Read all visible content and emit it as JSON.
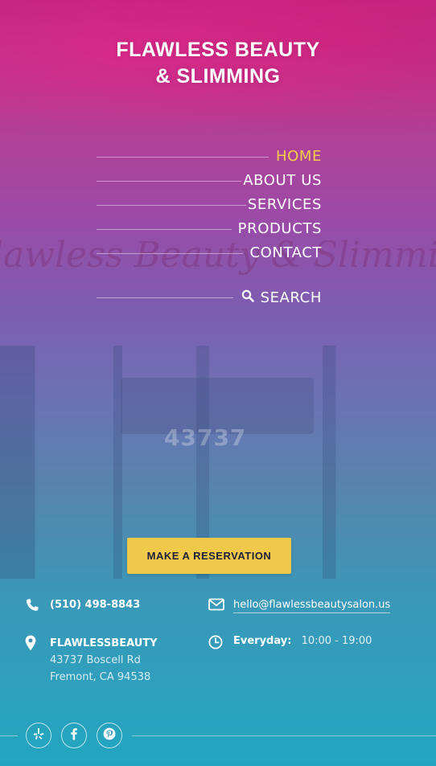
{
  "brand": {
    "line1": "FLAWLESS BEAUTY",
    "line2": "& SLIMMING"
  },
  "background_text": {
    "script": "lawless Beauty & Slimmi",
    "number": "43737"
  },
  "nav": {
    "items": [
      {
        "label": "HOME",
        "active": true
      },
      {
        "label": "ABOUT US",
        "active": false
      },
      {
        "label": "SERVICES",
        "active": false
      },
      {
        "label": "PRODUCTS",
        "active": false
      },
      {
        "label": "CONTACT",
        "active": false
      }
    ],
    "search_label": "SEARCH"
  },
  "cta": {
    "reserve_label": "MAKE A RESERVATION"
  },
  "contact": {
    "phone": "(510) 498-8843",
    "email": "hello@flawlessbeautysalon.us",
    "address_name": "FLAWLESSBEAUTY",
    "address_line1": "43737 Boscell Rd",
    "address_line2": "Fremont, CA 94538",
    "hours_label": "Everyday:",
    "hours_value": "10:00 - 19:00"
  },
  "social": {
    "icons": [
      "yelp-icon",
      "facebook-icon",
      "pinterest-icon"
    ]
  },
  "colors": {
    "accent": "#f5cd4b",
    "button": "#f0c84a",
    "button_text": "#1f1f3a",
    "top": "#c4247f",
    "bottom": "#22a6c0"
  }
}
